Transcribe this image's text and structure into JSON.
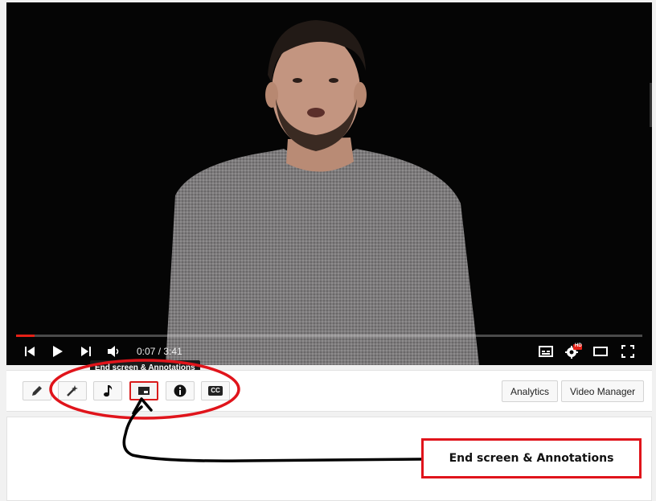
{
  "player": {
    "time_current": "0:07",
    "time_total": "3:41",
    "time_separator": " / ",
    "progress_fraction": 0.03,
    "icons": {
      "prev": "skip-previous-icon",
      "play": "play-icon",
      "next": "skip-next-icon",
      "volume": "volume-icon",
      "subtitles": "subtitles-icon",
      "settings": "settings-hd-icon",
      "theater": "theater-mode-icon",
      "fullscreen": "fullscreen-icon"
    },
    "hd_badge": "HD"
  },
  "toolbar": {
    "tooltip": "End screen & Annotations",
    "buttons": [
      {
        "icon": "pencil-icon",
        "label": "Info and Settings"
      },
      {
        "icon": "magic-wand-icon",
        "label": "Enhancements"
      },
      {
        "icon": "music-note-icon",
        "label": "Audio"
      },
      {
        "icon": "end-screen-icon",
        "label": "End screen & Annotations",
        "active": true
      },
      {
        "icon": "info-icon",
        "label": "Cards"
      },
      {
        "icon": "cc-icon",
        "label": "Subtitles/CC"
      }
    ],
    "cc_text": "CC",
    "analytics_label": "Analytics",
    "video_manager_label": "Video Manager"
  },
  "annotation": {
    "callout_text": "End screen & Annotations",
    "accent_color": "#e0141b",
    "arrow_color": "#000000"
  }
}
